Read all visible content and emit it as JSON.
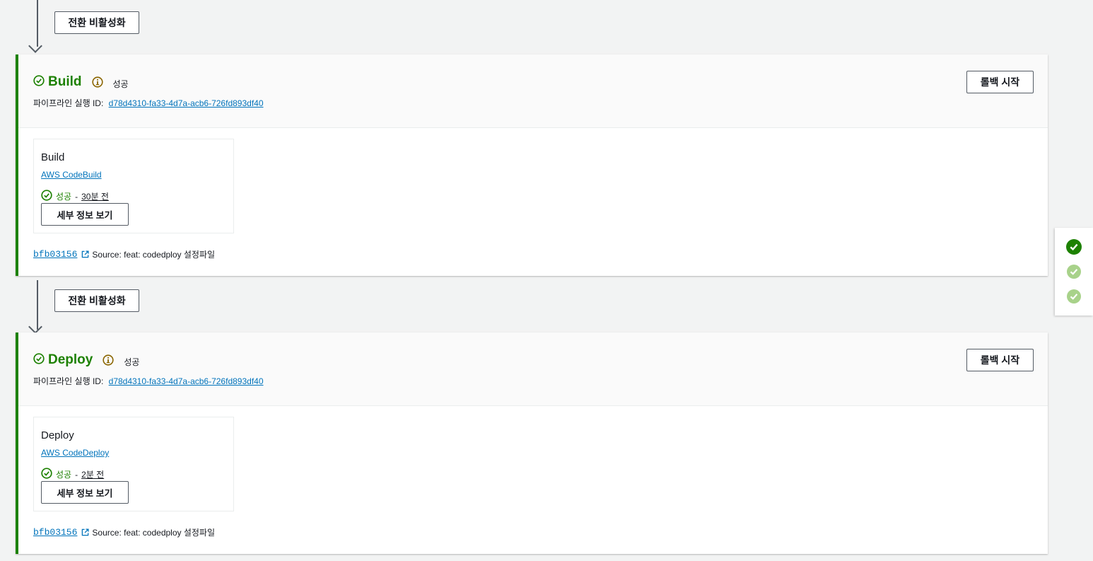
{
  "transitions": [
    {
      "button_label": "전환 비활성화"
    },
    {
      "button_label": "전환 비활성화"
    }
  ],
  "stages": [
    {
      "name": "Build",
      "status": "성공",
      "exec_id_label": "파이프라인 실행 ID:",
      "exec_id": "d78d4310-fa33-4d7a-acb6-726fd893df40",
      "rollback_label": "롤백 시작",
      "action": {
        "name": "Build",
        "provider": "AWS CodeBuild",
        "status": "성공",
        "separator": "-",
        "time": "30분 전",
        "details_label": "세부 정보 보기"
      },
      "source": {
        "commit": "bfb03156",
        "message": "Source: feat: codedploy 설정파일"
      }
    },
    {
      "name": "Deploy",
      "status": "성공",
      "exec_id_label": "파이프라인 실행 ID:",
      "exec_id": "d78d4310-fa33-4d7a-acb6-726fd893df40",
      "rollback_label": "롤백 시작",
      "action": {
        "name": "Deploy",
        "provider": "AWS CodeDeploy",
        "status": "성공",
        "separator": "-",
        "time": "2분 전",
        "details_label": "세부 정보 보기"
      },
      "source": {
        "commit": "bfb03156",
        "message": "Source: feat: codedploy 설정파일"
      }
    }
  ],
  "side_panel": {
    "items": [
      {
        "icon": "check-filled-icon",
        "state": "current"
      },
      {
        "icon": "check-filled-icon",
        "state": "faded"
      },
      {
        "icon": "check-filled-icon",
        "state": "faded"
      }
    ]
  },
  "colors": {
    "success": "#1d8102",
    "link": "#0073bb",
    "info": "#8a6500",
    "faded_check": "#a8d28a"
  }
}
